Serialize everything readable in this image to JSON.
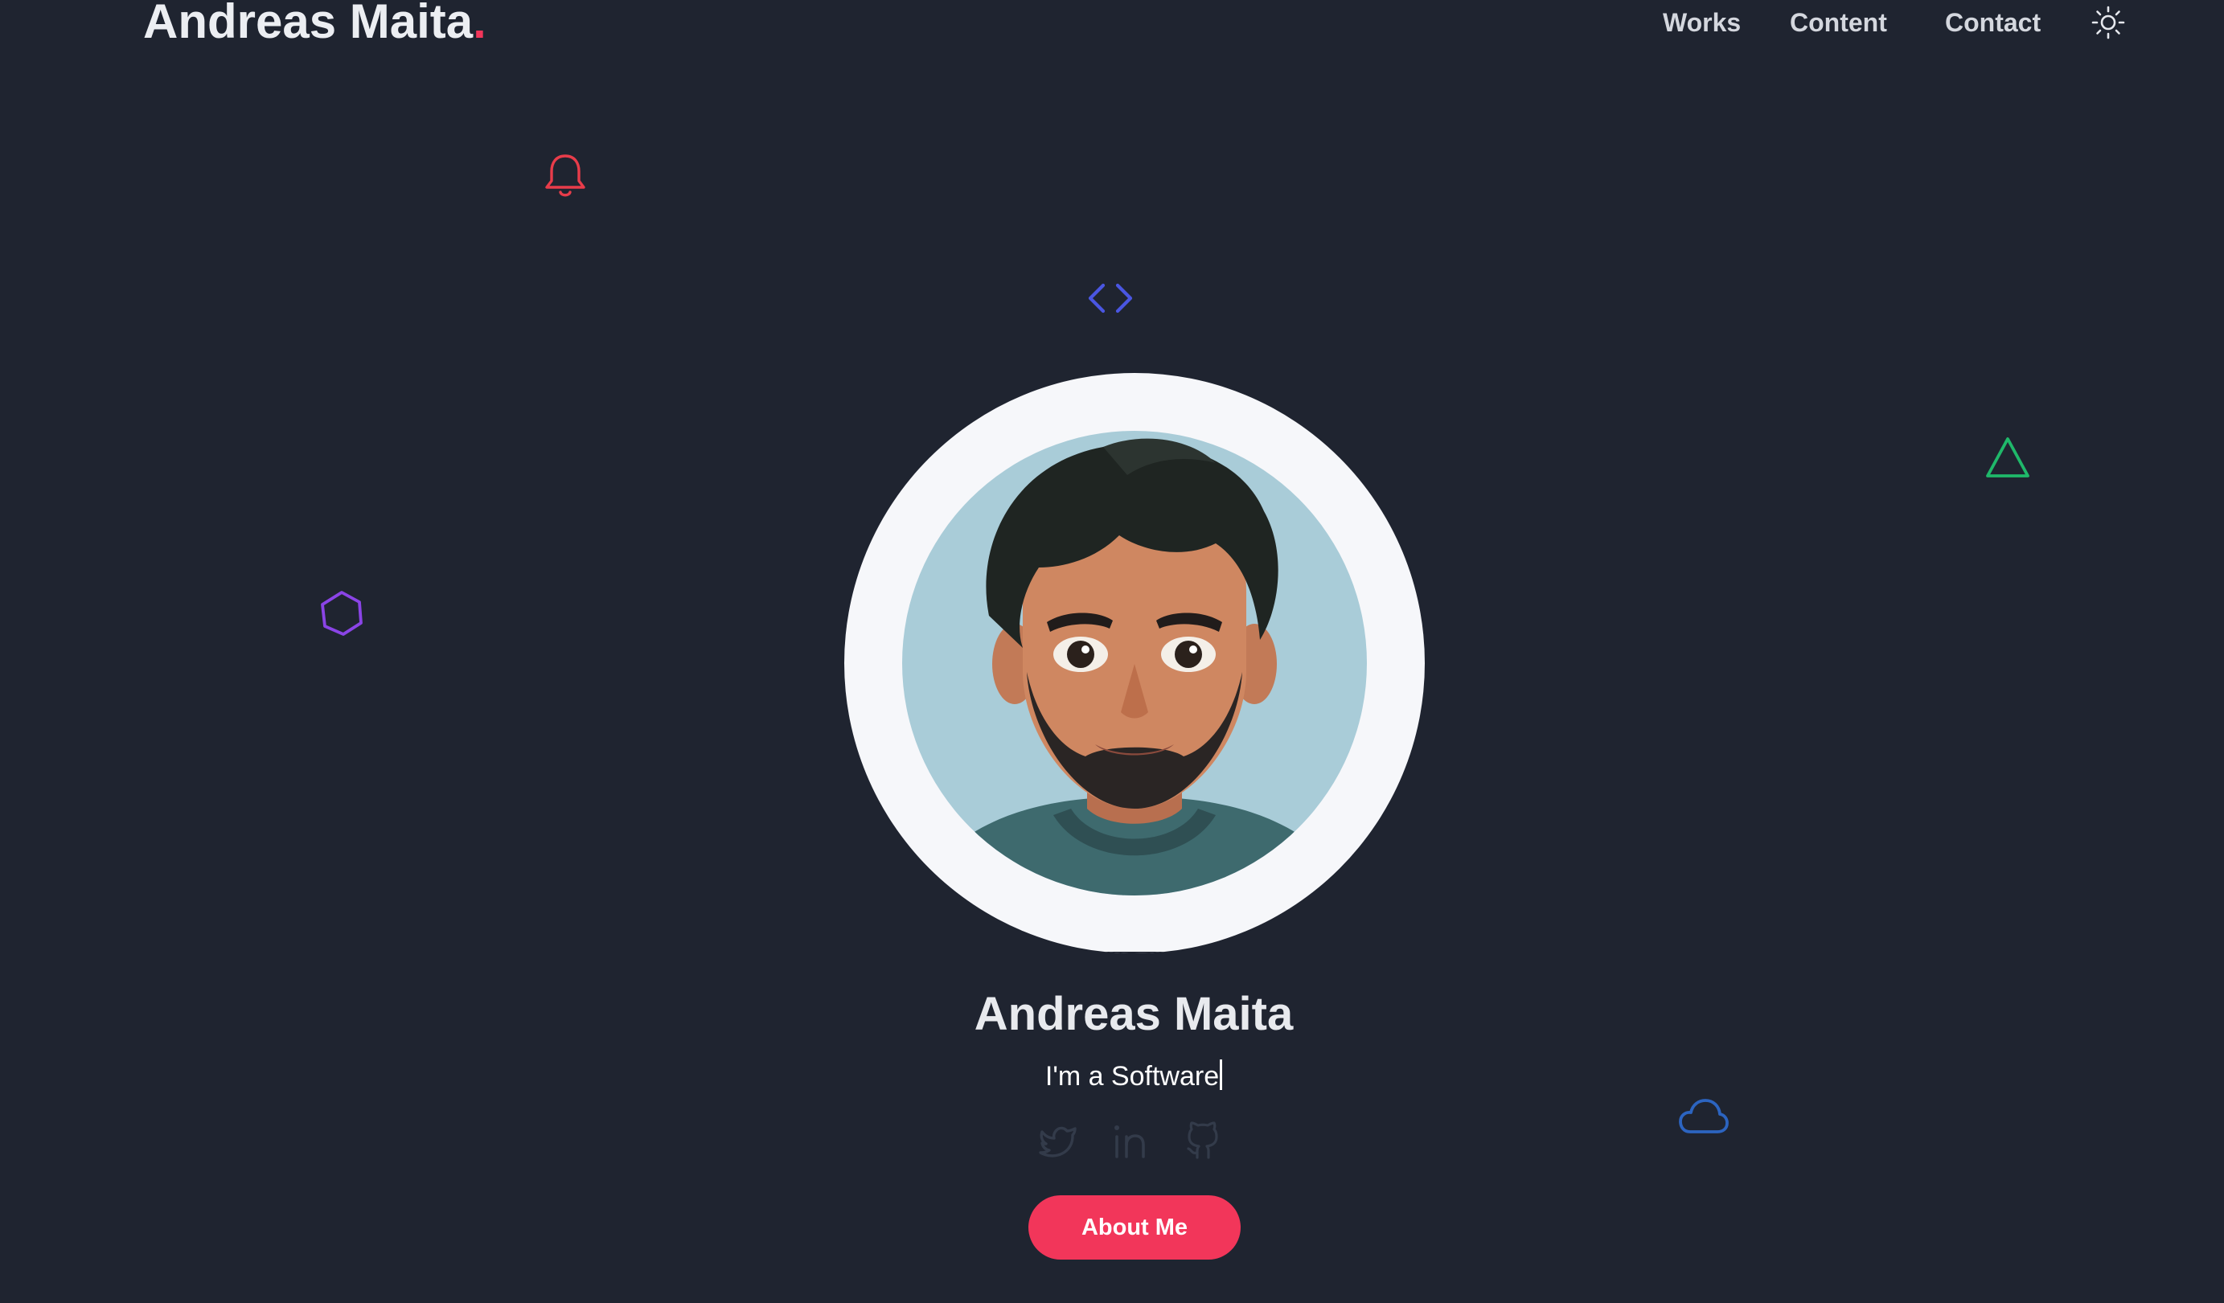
{
  "header": {
    "logo_text": "Andreas Maita",
    "logo_dot": ".",
    "nav": [
      {
        "label": "Works"
      },
      {
        "label": "Content"
      },
      {
        "label": "Contact"
      }
    ],
    "theme_toggle_icon": "sun-icon"
  },
  "hero": {
    "name": "Andreas Maita",
    "role_text": "I'm a Software",
    "avatar_icon": "avatar-illustration",
    "about_button": "About Me",
    "socials": [
      {
        "icon": "twitter-icon"
      },
      {
        "icon": "linkedin-icon"
      },
      {
        "icon": "github-icon"
      }
    ]
  },
  "decorations": {
    "icons": [
      "bell-icon",
      "code-icon",
      "triangle-icon",
      "hexagon-icon",
      "cloud-icon"
    ]
  },
  "colors": {
    "background": "#1f2430",
    "accent": "#f2365a",
    "bell": "#e83c4a",
    "code": "#4a56e2",
    "triangle": "#1fb86a",
    "hexagon": "#8a44e6",
    "cloud": "#2c64c0",
    "social_icons": "#333b4a"
  }
}
